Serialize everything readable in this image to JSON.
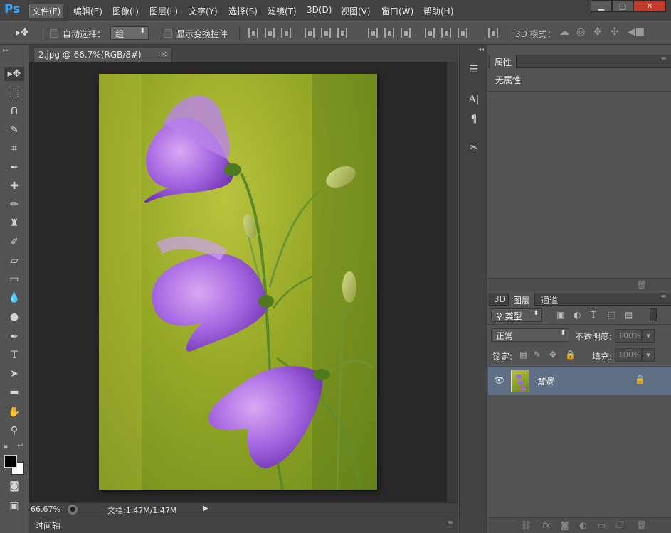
{
  "app": {
    "logo": "Ps"
  },
  "menu": [
    {
      "label": "文件(F)",
      "active": true
    },
    {
      "label": "编辑(E)"
    },
    {
      "label": "图像(I)"
    },
    {
      "label": "图层(L)"
    },
    {
      "label": "文字(Y)"
    },
    {
      "label": "选择(S)"
    },
    {
      "label": "滤镜(T)"
    },
    {
      "label": "3D(D)"
    },
    {
      "label": "视图(V)"
    },
    {
      "label": "窗口(W)"
    },
    {
      "label": "帮助(H)"
    }
  ],
  "window_controls": {
    "minimize": "▁",
    "maximize": "□",
    "close": "✕"
  },
  "options": {
    "auto_select_label": "自动选择：",
    "auto_select_checked": false,
    "auto_select_value": "组",
    "show_transform_label": "显示变换控件",
    "show_transform_checked": false,
    "mode_3d_label": "3D 模式："
  },
  "document": {
    "tab_title": "2.jpg @ 66.7%(RGB/8#)",
    "close_glyph": "×",
    "zoom": "66.67%",
    "doc_info": "文档:1.47M/1.47M"
  },
  "timeline_label": "时间轴",
  "properties": {
    "tab": "属性",
    "content": "无属性"
  },
  "layers": {
    "tabs": [
      {
        "label": "3D"
      },
      {
        "label": "图层",
        "active": true
      },
      {
        "label": "通道"
      }
    ],
    "filter_kind": "类型",
    "blend_mode": "正常",
    "opacity_label": "不透明度:",
    "opacity_value": "100%",
    "lock_label": "锁定:",
    "fill_label": "填充:",
    "fill_value": "100%",
    "items": [
      {
        "name": "背景",
        "visible": true,
        "locked": true
      }
    ]
  },
  "colors": {
    "accent": "#31a8ff",
    "selected_layer": "#5f6f86",
    "flower_purple": "#9a55d6"
  }
}
